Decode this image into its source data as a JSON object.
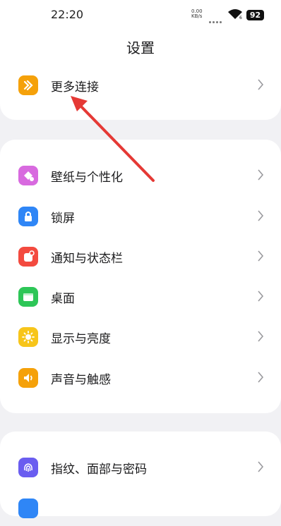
{
  "status": {
    "time": "22:20",
    "net_top": "0.00",
    "net_bottom": "KB/s",
    "battery": "92"
  },
  "header": {
    "title": "设置"
  },
  "groups": {
    "top": [
      {
        "label": "更多连接",
        "icon": "more-connections-icon",
        "color": "#f5a10a"
      }
    ],
    "display": [
      {
        "label": "壁纸与个性化",
        "icon": "wallpaper-icon",
        "color": "#d86adf"
      },
      {
        "label": "锁屏",
        "icon": "lock-icon",
        "color": "#2f86f6"
      },
      {
        "label": "通知与状态栏",
        "icon": "notification-icon",
        "color": "#f34a3f"
      },
      {
        "label": "桌面",
        "icon": "desktop-icon",
        "color": "#2dc657"
      },
      {
        "label": "显示与亮度",
        "icon": "brightness-icon",
        "color": "#f7c51a"
      },
      {
        "label": "声音与触感",
        "icon": "sound-icon",
        "color": "#f5a10a"
      }
    ],
    "security": [
      {
        "label": "指纹、面部与密码",
        "icon": "fingerprint-icon",
        "color": "#6a5df0"
      }
    ]
  },
  "colors": {
    "annotation_arrow": "#e53935",
    "background": "#f1f1f4"
  }
}
